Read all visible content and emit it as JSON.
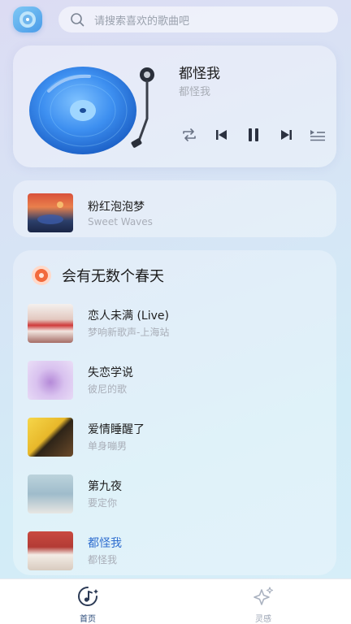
{
  "search": {
    "placeholder": "请搜索喜欢的歌曲吧"
  },
  "now_playing": {
    "title": "都怪我",
    "artist": "都怪我"
  },
  "mini_player": {
    "title": "粉红泡泡梦",
    "subtitle": "Sweet Waves"
  },
  "playlist": {
    "title": "会有无数个春天",
    "songs": [
      {
        "title": "恋人未满 (Live)",
        "subtitle": "梦响新歌声-上海站"
      },
      {
        "title": "失恋学说",
        "subtitle": "彼尼的歌"
      },
      {
        "title": "爱情睡醒了",
        "subtitle": "单身嘣男"
      },
      {
        "title": "第九夜",
        "subtitle": "要定你"
      },
      {
        "title": "都怪我",
        "subtitle": "都怪我"
      }
    ],
    "active_index": 4
  },
  "nav": {
    "home": "首页",
    "inspire": "灵感"
  },
  "colors": {
    "accent": "#2f6ecf",
    "vinyl": "#3a8ff0",
    "nav_active": "#2b4b7a"
  }
}
